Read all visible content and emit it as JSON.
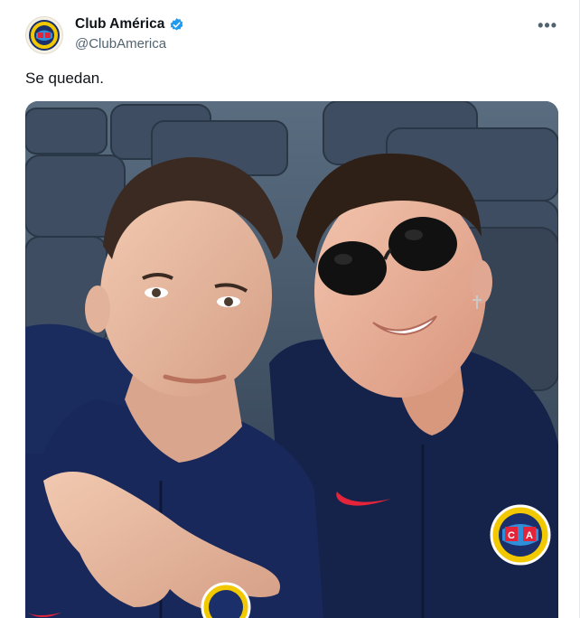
{
  "tweet": {
    "author_name": "Club América",
    "author_handle": "@ClubAmerica",
    "text": "Se quedan.",
    "verified": true,
    "more_icon": "more-horizontal-icon",
    "media_description_icon": "photo"
  },
  "colors": {
    "verified_blue": "#1d9bf0",
    "handle_gray": "#536471",
    "jersey_navy": "#15234a",
    "nike_swoosh": "#e4243a",
    "crest_yellow": "#f2c800"
  },
  "crest": {
    "letters_left": "C",
    "letters_right": "A"
  }
}
